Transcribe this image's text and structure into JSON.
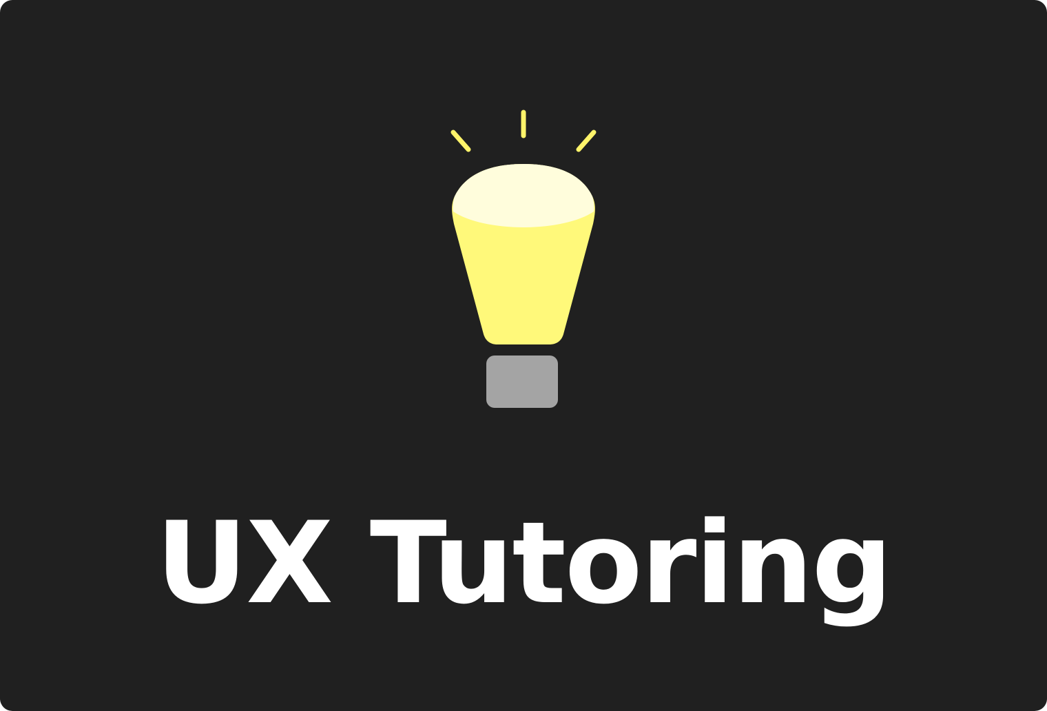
{
  "card": {
    "title": "UX Tutoring",
    "icon": "lightbulb-icon"
  },
  "colors": {
    "background": "#202020",
    "title": "#ffffff",
    "bulb_glass": "#fff97a",
    "bulb_highlight": "#fffddc",
    "bulb_base": "#a4a4a4",
    "rays": "#fff46a"
  }
}
